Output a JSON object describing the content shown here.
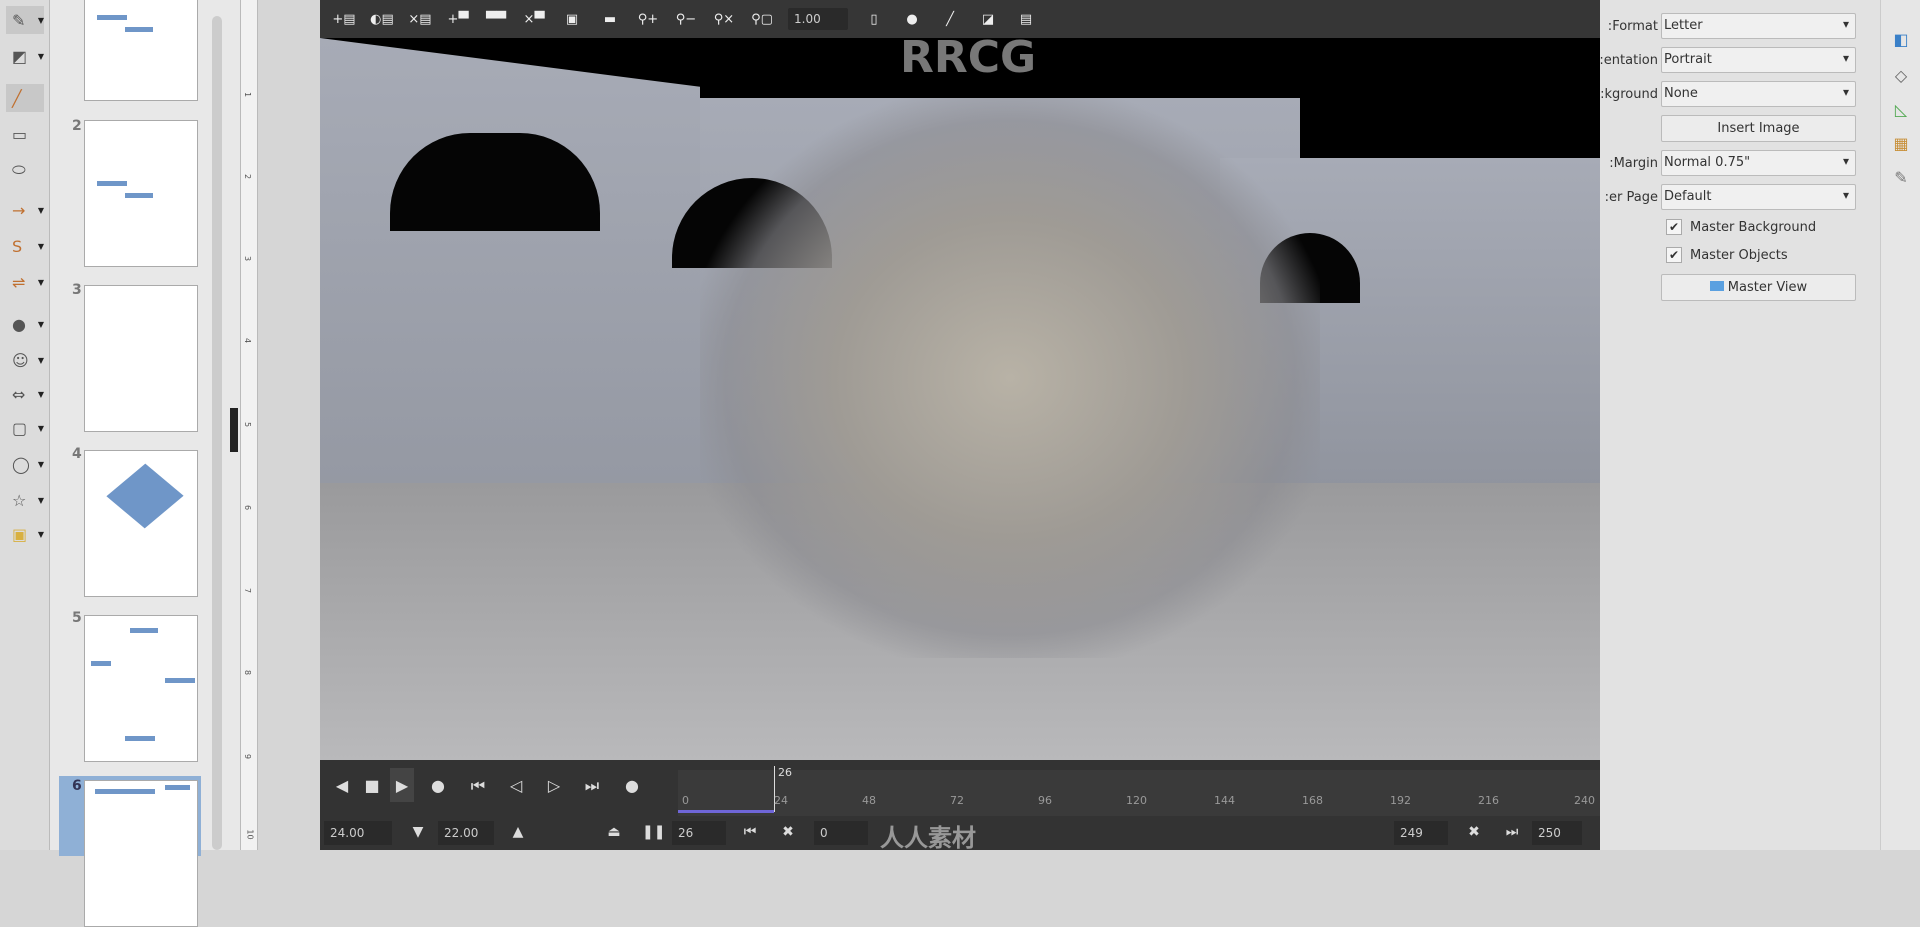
{
  "left_toolbar": {
    "tools": [
      "line-color",
      "fill-color",
      "line",
      "rectangle",
      "ellipse",
      "arrow-line",
      "curve",
      "connector",
      "basic-shapes",
      "symbol-shapes",
      "block-arrows",
      "flowchart",
      "callouts",
      "stars",
      "3d-objects"
    ]
  },
  "slides": {
    "numbers": [
      "2",
      "3",
      "4",
      "5",
      "6"
    ],
    "selected": "6"
  },
  "ruler": {
    "marks": [
      "1",
      "2",
      "3",
      "4",
      "5",
      "6",
      "7",
      "8",
      "9",
      "10"
    ]
  },
  "viewer": {
    "zoom": "1.00",
    "watermark": "RRCG",
    "timeline": {
      "current_frame": "26",
      "ticks": [
        "0",
        "24",
        "48",
        "72",
        "96",
        "120",
        "144",
        "168",
        "192",
        "216",
        "240"
      ],
      "fps": "24.00",
      "fps2": "22.00",
      "frame": "26",
      "offset": "0",
      "end_frame": "249",
      "last": "250"
    },
    "logo_text": "人人素材"
  },
  "properties": {
    "format_label": "Format:",
    "format": "Letter",
    "orientation_label": "entation:",
    "orientation": "Portrait",
    "background_label": "kground:",
    "background": "None",
    "insert_image": "Insert Image",
    "margin_label": "Margin:",
    "margin": "Normal 0.75\"",
    "master_page_label": "er Page:",
    "master_page": "Default",
    "master_background": "Master Background",
    "master_background_checked": true,
    "master_objects": "Master Objects",
    "master_objects_checked": true,
    "master_view": "Master View"
  }
}
